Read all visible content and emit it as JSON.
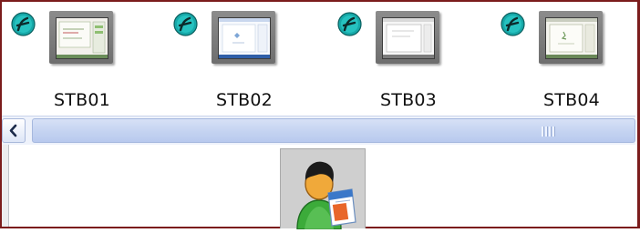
{
  "stations": [
    {
      "label": "STB01",
      "badge_icon": "agent-logo-icon",
      "preview_icon": "desktop-thumbnail-icon"
    },
    {
      "label": "STB02",
      "badge_icon": "agent-logo-icon",
      "preview_icon": "desktop-thumbnail-icon"
    },
    {
      "label": "STB03",
      "badge_icon": "agent-logo-icon",
      "preview_icon": "desktop-thumbnail-icon"
    },
    {
      "label": "STB04",
      "badge_icon": "agent-logo-icon",
      "preview_icon": "desktop-thumbnail-icon"
    }
  ],
  "scrollbar": {
    "left_arrow_icon": "chevron-left-icon",
    "thumb_grip_icon": "scroll-grip-icon"
  },
  "user_panel": {
    "icon": "user-document-icon"
  },
  "colors": {
    "frame_border": "#7b1c1c",
    "scroll_track": "#eef2fb",
    "scroll_thumb": "#c4d3f1",
    "badge_teal": "#1aa3a3"
  }
}
